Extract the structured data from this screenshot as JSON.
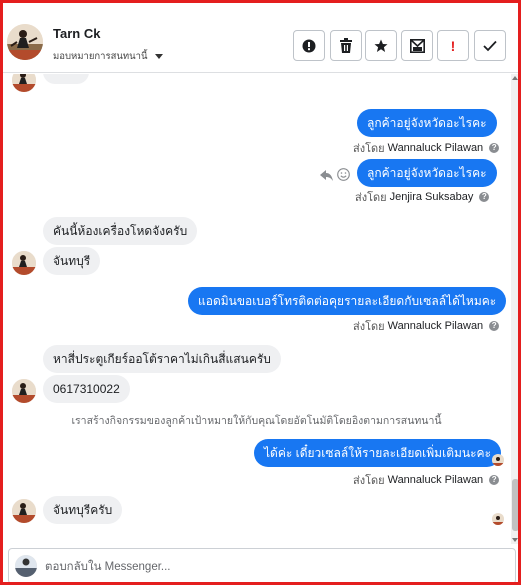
{
  "header": {
    "name": "Tarn Ck",
    "assign_label": "มอบหมายการสนทนานี้",
    "toolbar": {
      "spam": "alert-circle-icon",
      "delete": "trash-icon",
      "star": "star-icon",
      "archive": "mail-archive-icon",
      "important": "!",
      "done": "check-icon"
    }
  },
  "messages": {
    "m1": "ลูกค้าอยู่จังหวัดอะไรคะ",
    "m1_sentby_prefix": "ส่งโดย",
    "m1_sender": "Wannaluck Pilawan",
    "m2": "ลูกค้าอยู่จังหวัดอะไรคะ",
    "m2_sentby_prefix": "ส่งโดย",
    "m2_sender": "Jenjira Suksabay",
    "m3": "คันนี้ห้องเครื่องโหดจังครับ",
    "m4": "จันทบุรี",
    "m5": "แอดมินขอเบอร์โทรติดต่อคุยรายละเอียดกับเซลล์ได้ไหมคะ",
    "m5_sentby_prefix": "ส่งโดย",
    "m5_sender": "Wannaluck Pilawan",
    "m6": "หาสี่ประตูเกียร์ออโต้ราคาไม่เกินสี่แสนครับ",
    "m7": "0617310022",
    "system": "เราสร้างกิจกรรมของลูกค้าเป้าหมายให้กับคุณโดยอัตโนมัติโดยอิงตามการสนทนานี้",
    "m8": "ได้ค่ะ  เดี๋ยวเซลล์ให้รายละเอียดเพิ่มเติมนะคะ",
    "m8_sentby_prefix": "ส่งโดย",
    "m8_sender": "Wannaluck Pilawan",
    "m9": "จันทบุรีครับ"
  },
  "composer": {
    "placeholder": "ตอบกลับใน Messenger..."
  },
  "colors": {
    "frame": "#e41e1e",
    "outgoing_bubble": "#1877f2",
    "incoming_bubble": "#eff0f2",
    "important_icon": "#e41e1e"
  }
}
